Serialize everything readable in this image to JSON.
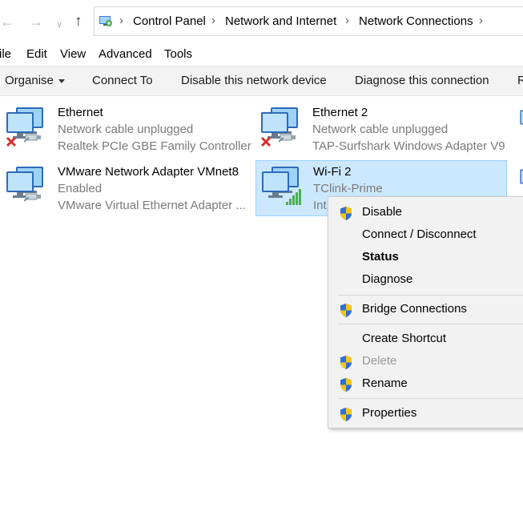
{
  "breadcrumb": {
    "items": [
      "Control Panel",
      "Network and Internet",
      "Network Connections"
    ]
  },
  "menubar": {
    "file": "ile",
    "edit": "Edit",
    "view": "View",
    "advanced": "Advanced",
    "tools": "Tools"
  },
  "commandbar": {
    "organise": "Organise",
    "connect_to": "Connect To",
    "disable_device": "Disable this network device",
    "diagnose": "Diagnose this connection",
    "cut_label": "R"
  },
  "adapters": [
    {
      "name": "Ethernet",
      "status": "Network cable unplugged",
      "device": "Realtek PCIe GBE Family Controller",
      "state": "unplugged"
    },
    {
      "name": "Ethernet 2",
      "status": "Network cable unplugged",
      "device": "TAP-Surfshark Windows Adapter V9",
      "state": "unplugged"
    },
    {
      "name": "VMware Network Adapter VMnet8",
      "status": "Enabled",
      "device": "VMware Virtual Ethernet Adapter ...",
      "state": "enabled"
    },
    {
      "name": "Wi-Fi 2",
      "status": "TClink-Prime",
      "device": "Int",
      "state": "wifi",
      "selected": true
    }
  ],
  "context_menu": {
    "items": [
      {
        "label": "Disable",
        "shield": true
      },
      {
        "label": "Connect / Disconnect",
        "shield": false
      },
      {
        "label": "Status",
        "shield": false,
        "bold": true
      },
      {
        "label": "Diagnose",
        "shield": false
      },
      {
        "label": "Bridge Connections",
        "shield": true
      },
      {
        "label": "Create Shortcut",
        "shield": false
      },
      {
        "label": "Delete",
        "shield": true,
        "disabled": true
      },
      {
        "label": "Rename",
        "shield": true
      },
      {
        "label": "Properties",
        "shield": true
      }
    ]
  },
  "colors": {
    "selection_bg": "#cce8ff",
    "selection_border": "#99d1ff",
    "status_gray": "#7a7a7a",
    "menu_bg": "#f2f2f2",
    "wifi_green": "#4caf50",
    "error_red": "#d32f2f"
  }
}
